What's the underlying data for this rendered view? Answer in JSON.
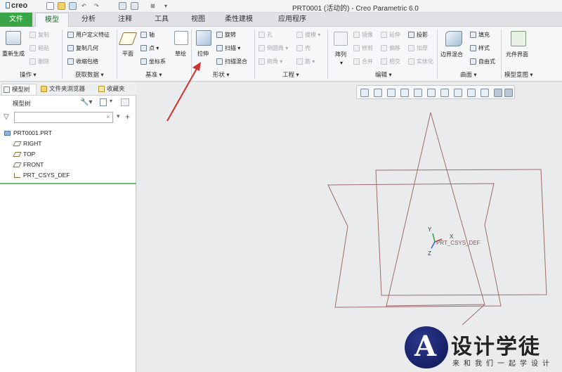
{
  "app": {
    "logo": "creo",
    "window_title": "PRT0001 (活动的) - Creo Parametric 6.0"
  },
  "tabs": [
    {
      "label": "文件"
    },
    {
      "label": "模型"
    },
    {
      "label": "分析"
    },
    {
      "label": "注释"
    },
    {
      "label": "工具"
    },
    {
      "label": "视图"
    },
    {
      "label": "柔性建模"
    },
    {
      "label": "应用程序"
    }
  ],
  "ribbon": {
    "operations": {
      "regen": "重新生成",
      "copy": "复制",
      "paste": "粘贴",
      "delete": "删除",
      "group": "操作"
    },
    "get_data": {
      "udf": "用户定义特征",
      "copy_geom": "复制几何",
      "shrinkwrap": "收缩包络",
      "group": "获取数据"
    },
    "datum": {
      "plane": "平面",
      "axis": "轴",
      "point": "点",
      "csys": "坐标系",
      "sketch": "草绘",
      "group": "基准"
    },
    "shapes": {
      "extrude": "拉伸",
      "revolve": "旋转",
      "sweep": "扫描",
      "swept_blend": "扫描混合",
      "group": "形状"
    },
    "engineering": {
      "hole": "孔",
      "draft": "拔模",
      "round": "倒圆角",
      "shell": "壳",
      "chamfer": "倒角",
      "rib": "筋",
      "group": "工程"
    },
    "editing": {
      "pattern": "阵列",
      "mirror": "镜像",
      "extend": "延伸",
      "project": "投影",
      "trim": "修剪",
      "offset": "偏移",
      "thicken": "加厚",
      "merge": "合并",
      "intersect": "相交",
      "solidify": "实体化",
      "group": "编辑"
    },
    "surfaces": {
      "boundary_blend": "边界混合",
      "fill": "填充",
      "style": "样式",
      "freestyle": "自由式",
      "group": "曲面"
    },
    "model_intent": {
      "component_interface": "元件界面",
      "group": "模型意图"
    }
  },
  "panel": {
    "tabs": [
      {
        "label": "模型树"
      },
      {
        "label": "文件夹浏览器"
      },
      {
        "label": "收藏夹"
      }
    ],
    "tree_header": "模型树",
    "search_placeholder": "",
    "tree": [
      {
        "label": "PRT0001.PRT"
      },
      {
        "label": "RIGHT"
      },
      {
        "label": "TOP"
      },
      {
        "label": "FRONT"
      },
      {
        "label": "PRT_CSYS_DEF"
      }
    ]
  },
  "scene": {
    "csys_label": "PRT_CSYS_DEF",
    "axis_x": "X",
    "axis_y": "Y",
    "axis_z": "Z"
  },
  "watermark": {
    "logo_letter": "A",
    "title": "设计学徒",
    "subtitle": "来和我们一起学设计"
  },
  "colors": {
    "accent_green": "#3aa547",
    "datum_plane": "#a06b6b",
    "arrow": "#d0312d"
  }
}
